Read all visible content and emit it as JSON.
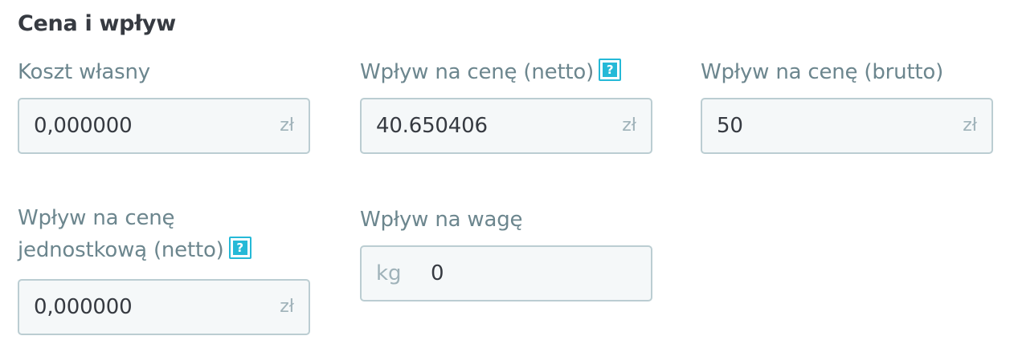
{
  "section": {
    "title": "Cena i wpływ"
  },
  "fields": {
    "cost_price": {
      "label": "Koszt własny",
      "value": "0,000000",
      "unit": "zł"
    },
    "impact_net": {
      "label": "Wpływ na cenę (netto)",
      "value": "40.650406",
      "unit": "zł",
      "help": "?"
    },
    "impact_gross": {
      "label": "Wpływ na cenę (brutto)",
      "value": "50",
      "unit": "zł"
    },
    "unit_impact_net": {
      "label_line1": "Wpływ na cenę",
      "label_line2": "jednostkową (netto)",
      "value": "0,000000",
      "unit": "zł",
      "help": "?"
    },
    "weight_impact": {
      "label": "Wpływ na wagę",
      "value": "0",
      "unit": "kg"
    }
  },
  "colors": {
    "label": "#6c868e",
    "input_bg": "#f5f8f9",
    "input_border": "#bbcdd2",
    "help_icon": "#25b9d7",
    "text": "#363a41",
    "unit": "#9fb2b9"
  }
}
